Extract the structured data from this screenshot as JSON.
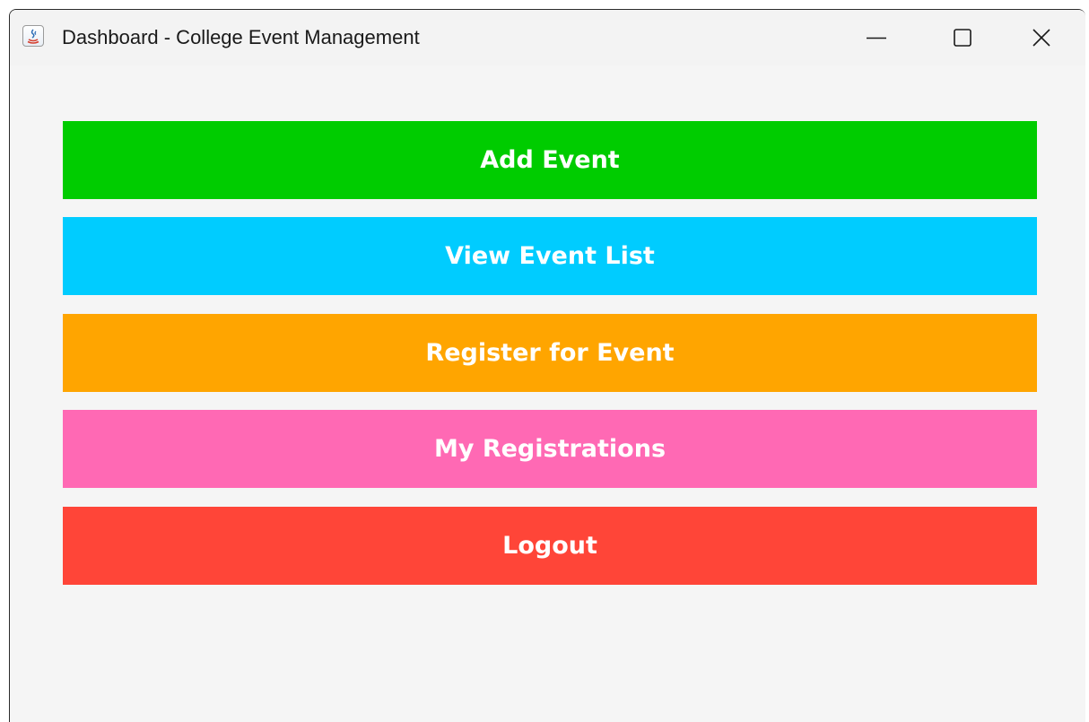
{
  "window": {
    "title": "Dashboard - College Event Management",
    "app_icon": "java-icon",
    "controls": {
      "minimize_icon": "minimize-icon",
      "maximize_icon": "maximize-icon",
      "close_icon": "close-icon"
    }
  },
  "dashboard": {
    "buttons": [
      {
        "label": "Add Event",
        "color": "#00cc00"
      },
      {
        "label": "View Event List",
        "color": "#00ccff"
      },
      {
        "label": "Register for Event",
        "color": "#ffa500"
      },
      {
        "label": "My Registrations",
        "color": "#ff69b4"
      },
      {
        "label": "Logout",
        "color": "#ff4538"
      }
    ]
  }
}
